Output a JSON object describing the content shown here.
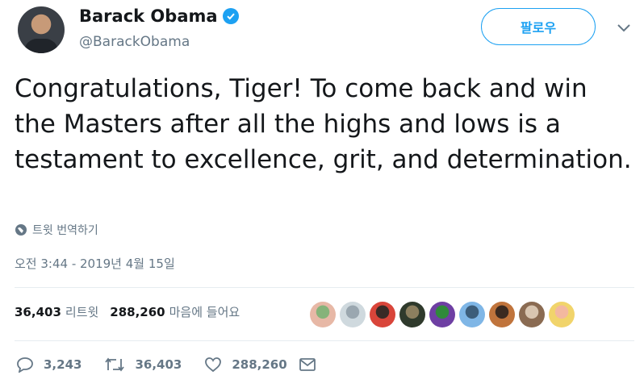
{
  "author": {
    "name": "Barack Obama",
    "handle": "@BarackObama",
    "verified": true
  },
  "follow_label": "팔로우",
  "tweet": {
    "text": "Congratulations, Tiger! To come back and win the Masters after all the highs and lows is a testament to excellence, grit, and determination.",
    "translate_label": "트윗 번역하기",
    "timestamp": "오전 3:44 - 2019년 4월 15일"
  },
  "stats": {
    "retweets_count": "36,403",
    "retweets_label": "리트윗",
    "likes_count": "288,260",
    "likes_label": "마음에 들어요"
  },
  "liker_avatars": [
    {
      "colors": [
        "#e7b8a6",
        "#86b37a"
      ]
    },
    {
      "colors": [
        "#cfd9de",
        "#9aa7b0"
      ]
    },
    {
      "colors": [
        "#d9453a",
        "#3a2a26"
      ]
    },
    {
      "colors": [
        "#2f3a2c",
        "#8c7f5f"
      ]
    },
    {
      "colors": [
        "#6e3fa3",
        "#2f8a3a"
      ]
    },
    {
      "colors": [
        "#7fb6e6",
        "#3c5d7a"
      ]
    },
    {
      "colors": [
        "#c0743c",
        "#3b2a20"
      ]
    },
    {
      "colors": [
        "#8a6b52",
        "#d8c5b0"
      ]
    },
    {
      "colors": [
        "#f1d46b",
        "#f3b8a0"
      ]
    }
  ],
  "actions": {
    "replies": "3,243",
    "retweets": "36,403",
    "likes": "288,260"
  },
  "colors": {
    "accent": "#1da1f2",
    "text": "#14171a",
    "secondary": "#657786",
    "divider": "#e6ecf0"
  },
  "icons": [
    "verified-badge-icon",
    "chevron-down-icon",
    "globe-icon",
    "reply-icon",
    "retweet-icon",
    "like-icon",
    "direct-message-icon"
  ]
}
